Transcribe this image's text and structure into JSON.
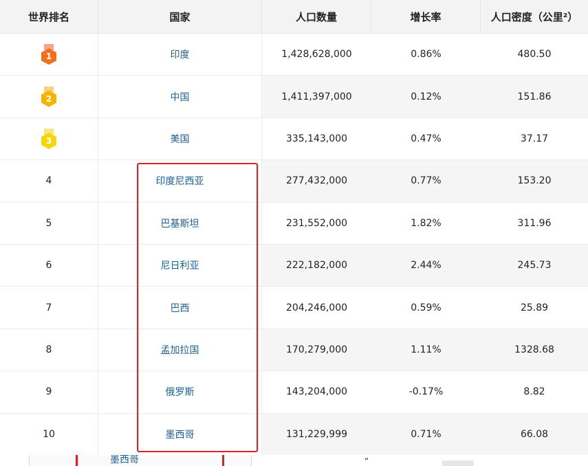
{
  "columns": {
    "rank": "世界排名",
    "country": "国家",
    "population": "人口数量",
    "growth": "增长率",
    "density": "人口密度（公里²）"
  },
  "medal_colors": {
    "1": {
      "ribbon": "#f5a58a",
      "body": "#f07020"
    },
    "2": {
      "ribbon": "#f5d27a",
      "body": "#f5b400"
    },
    "3": {
      "ribbon": "#f7e684",
      "body": "#f5d60a"
    }
  },
  "rows": [
    {
      "rank": "1",
      "medal": true,
      "country": "印度",
      "population": "1,428,628,000",
      "growth": "0.86%",
      "density": "480.50"
    },
    {
      "rank": "2",
      "medal": true,
      "country": "中国",
      "population": "1,411,397,000",
      "growth": "0.12%",
      "density": "151.86"
    },
    {
      "rank": "3",
      "medal": true,
      "country": "美国",
      "population": "335,143,000",
      "growth": "0.47%",
      "density": "37.17"
    },
    {
      "rank": "4",
      "medal": false,
      "country": "印度尼西亚",
      "population": "277,432,000",
      "growth": "0.77%",
      "density": "153.20"
    },
    {
      "rank": "5",
      "medal": false,
      "country": "巴基斯坦",
      "population": "231,552,000",
      "growth": "1.82%",
      "density": "311.96"
    },
    {
      "rank": "6",
      "medal": false,
      "country": "尼日利亚",
      "population": "222,182,000",
      "growth": "2.44%",
      "density": "245.73"
    },
    {
      "rank": "7",
      "medal": false,
      "country": "巴西",
      "population": "204,246,000",
      "growth": "0.59%",
      "density": "25.89"
    },
    {
      "rank": "8",
      "medal": false,
      "country": "孟加拉国",
      "population": "170,279,000",
      "growth": "1.11%",
      "density": "1328.68"
    },
    {
      "rank": "9",
      "medal": false,
      "country": "俄罗斯",
      "population": "143,204,000",
      "growth": "-0.17%",
      "density": "8.82"
    },
    {
      "rank": "10",
      "medal": false,
      "country": "墨西哥",
      "population": "131,229,999",
      "growth": "0.71%",
      "density": "66.08"
    }
  ],
  "peek": {
    "text": "墨西哥"
  }
}
